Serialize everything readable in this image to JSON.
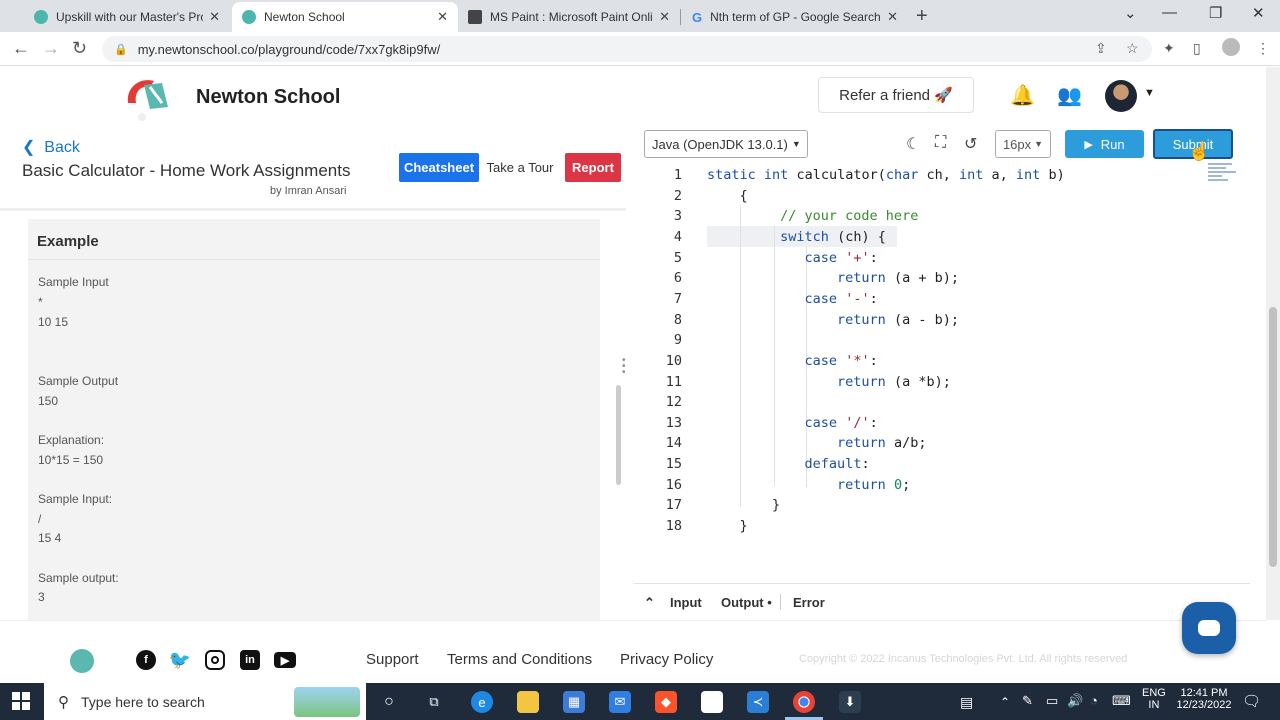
{
  "browser": {
    "tabs": [
      {
        "title": "Upskill with our Master's Program",
        "active": false,
        "favicon": "newton-favicon"
      },
      {
        "title": "Newton School",
        "active": true,
        "favicon": "newton-favicon"
      },
      {
        "title": "MS Paint : Microsoft Paint Online",
        "active": false,
        "favicon": "paint-favicon"
      },
      {
        "title": "Nth term of GP - Google Search",
        "active": false,
        "favicon": "google-favicon"
      }
    ],
    "url": "my.newtonschool.co/playground/code/7xx7gk8ip9fw/"
  },
  "header": {
    "brand": "Newton School",
    "refer_label": "Refer a friend",
    "refer_icon": "🚀"
  },
  "problem": {
    "back_label": "Back",
    "title": "Basic Calculator - Home Work Assignments",
    "author": "by Imran Ansari",
    "cheatsheet_label": "Cheatsheet",
    "tour_label": "Take a Tour",
    "report_label": "Report",
    "example_heading": "Example",
    "example_lines": [
      "Sample Input",
      "*",
      "10 15",
      "Sample Output",
      "150",
      "Explanation:",
      "10*15 = 150",
      "Sample Input:",
      "/",
      "15 4",
      "Sample output:",
      "3"
    ]
  },
  "editor": {
    "language": "Java (OpenJDK 13.0.1)",
    "font_size": "16px",
    "run_label": "Run",
    "submit_label": "Submit",
    "line_numbers": [
      "1",
      "2",
      "3",
      "4",
      "5",
      "6",
      "7",
      "8",
      "9",
      "10",
      "11",
      "12",
      "13",
      "14",
      "15",
      "16",
      "17",
      "18"
    ],
    "code_lines": [
      "static int calculator(char ch, int a, int b)",
      "    {",
      "         // your code here",
      "         switch (ch) {",
      "            case '+':",
      "                return (a + b);",
      "            case '-':",
      "                return (a - b);",
      "",
      "            case '*':",
      "                return (a *b);",
      "",
      "            case '/':",
      "                return a/b;",
      "            default:",
      "                return 0;",
      "        }",
      "    }"
    ],
    "bottom_tabs": [
      "Input",
      "Output •",
      "Error"
    ]
  },
  "footer": {
    "links": [
      "Support",
      "Terms and Conditions",
      "Privacy Policy"
    ],
    "copyright": "Copyright © 2022 Incanus Technologies Pvt. Ltd. All rights reserved",
    "social_icons": [
      "facebook-icon",
      "twitter-icon",
      "instagram-icon",
      "linkedin-icon",
      "youtube-icon"
    ]
  },
  "taskbar": {
    "search_placeholder": "Type here to search",
    "language_line1": "ENG",
    "language_line2": "IN",
    "time": "12:41 PM",
    "date": "12/23/2022"
  },
  "colors": {
    "accent_blue": "#2d9cdb",
    "cheatsheet_blue": "#1a73e8",
    "report_red": "#dc3545",
    "keyword": "#1c4fa0",
    "comment": "#3a8a2e"
  }
}
